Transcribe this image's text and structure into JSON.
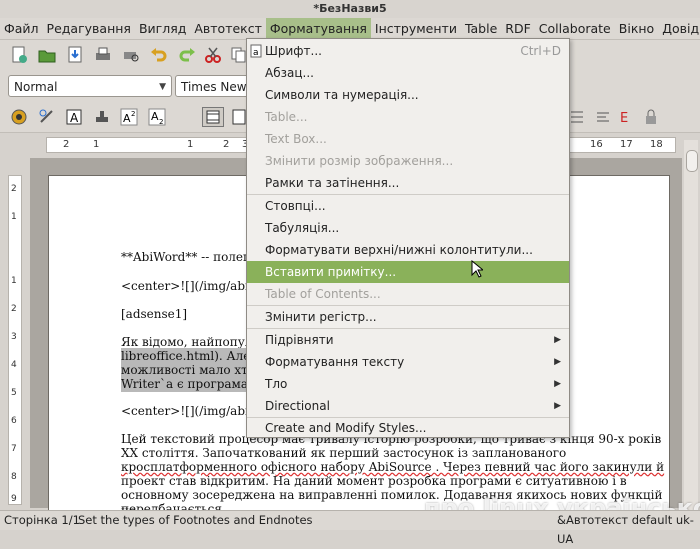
{
  "window": {
    "title": "*БезНазви5"
  },
  "menubar": {
    "items": [
      "Файл",
      "Редагування",
      "Вигляд",
      "Автотекст",
      "Форматування",
      "Інструменти",
      "Table",
      "RDF",
      "Collaborate",
      "Вікно",
      "Довідка"
    ],
    "active_index": 4
  },
  "toolbar": {
    "style_value": "Normal",
    "font_value": "Times New"
  },
  "ruler": {
    "ticks": [
      "2",
      "1",
      "1",
      "2",
      "3",
      "16",
      "17",
      "18"
    ]
  },
  "vruler": {
    "ticks": [
      "2",
      "1",
      "1",
      "2",
      "3",
      "4",
      "5",
      "6",
      "7",
      "8",
      "9",
      "10"
    ]
  },
  "document": {
    "lines": [
      "**AbiWord** -- полегш",
      "<center>![](/img/abiwor",
      "[adsense1]",
      "Як відомо, найпопуляр",
      "libreoffice.html). Але не",
      "можливості мало хто ви",
      "Writer`a є програма під",
      "<center>![](/img/abiwor",
      "Цей текстовий процесор має тривалу історію розробки, що триває з кінця 90-х років",
      "XX століття. Започаткований як перший застосунок із запланованого",
      "кросплатформенного офісного набору   AbiSource  . Через певний час його закинули й",
      "проект став відкритим. На даний момент розробка програми є ситуативною і в",
      "основному зосереджена на виправленні помилок. Додавання якихось нових функцій не",
      "передбачається."
    ]
  },
  "format_menu": {
    "items": [
      {
        "label": "Шрифт...",
        "accel": "Ctrl+D",
        "disabled": false,
        "submenu": false
      },
      {
        "label": "Абзац...",
        "accel": "",
        "disabled": false,
        "submenu": false
      },
      {
        "label": "Символи та нумерація...",
        "accel": "",
        "disabled": false,
        "submenu": false
      },
      {
        "label": "Table...",
        "accel": "",
        "disabled": true,
        "submenu": false
      },
      {
        "label": "Text Box...",
        "accel": "",
        "disabled": true,
        "submenu": false
      },
      {
        "label": "Змінити розмір зображення...",
        "accel": "",
        "disabled": true,
        "submenu": false
      },
      {
        "label": "Рамки та затінення...",
        "accel": "",
        "disabled": false,
        "submenu": false
      },
      {
        "label": "Стовпці...",
        "accel": "",
        "disabled": false,
        "submenu": false
      },
      {
        "label": "Табуляція...",
        "accel": "",
        "disabled": false,
        "submenu": false
      },
      {
        "label": "Форматувати верхні/нижні колонтитули...",
        "accel": "",
        "disabled": false,
        "submenu": false
      },
      {
        "label": "Вставити примітку...",
        "accel": "",
        "disabled": false,
        "submenu": false,
        "highlighted": true
      },
      {
        "label": "Table of Contents...",
        "accel": "",
        "disabled": true,
        "submenu": false
      },
      {
        "label": "Змінити регістр...",
        "accel": "",
        "disabled": false,
        "submenu": false
      },
      {
        "label": "Підрівняти",
        "accel": "",
        "disabled": false,
        "submenu": true
      },
      {
        "label": "Форматування тексту",
        "accel": "",
        "disabled": false,
        "submenu": true
      },
      {
        "label": "Тло",
        "accel": "",
        "disabled": false,
        "submenu": true
      },
      {
        "label": "Directional",
        "accel": "",
        "disabled": false,
        "submenu": true
      },
      {
        "label": "Create and Modify Styles...",
        "accel": "",
        "disabled": false,
        "submenu": false
      }
    ]
  },
  "statusbar": {
    "page": "Сторінка 1/1",
    "hint": "Set the types of Footnotes and Endnotes",
    "right": "&Автотекст default uk-UA"
  },
  "watermark": "про linux українською",
  "colors": {
    "menu_highlight": "#8ab15a",
    "active_menu": "#a8bf8a"
  }
}
